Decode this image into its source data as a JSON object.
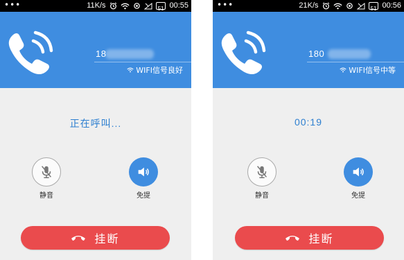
{
  "screens": [
    {
      "status_bar": {
        "dots": "•••",
        "speed": "11K/s",
        "battery": "51",
        "time": "00:55"
      },
      "header": {
        "number": "18",
        "signal_text": "WIFI信号良好"
      },
      "call_status": "正在呼叫...",
      "controls": {
        "mute_label": "静音",
        "speaker_label": "免提"
      },
      "hangup_label": "挂断"
    },
    {
      "status_bar": {
        "dots": "•••",
        "speed": "21K/s",
        "battery": "51",
        "time": "00:56"
      },
      "header": {
        "number": "180",
        "signal_text": "WIFI信号中等"
      },
      "call_status": "00:19",
      "controls": {
        "mute_label": "静音",
        "speaker_label": "免提"
      },
      "hangup_label": "挂断"
    }
  ],
  "colors": {
    "header_blue": "#3f8de0",
    "accent_text": "#2d7fd0",
    "hangup_red": "#ea4b4d",
    "status_bar": "#000000"
  },
  "icons": [
    "phone-icon",
    "wifi-icon",
    "alarm-icon",
    "signal-icon",
    "mute-mic-icon",
    "speaker-icon",
    "hangup-handset-icon"
  ]
}
